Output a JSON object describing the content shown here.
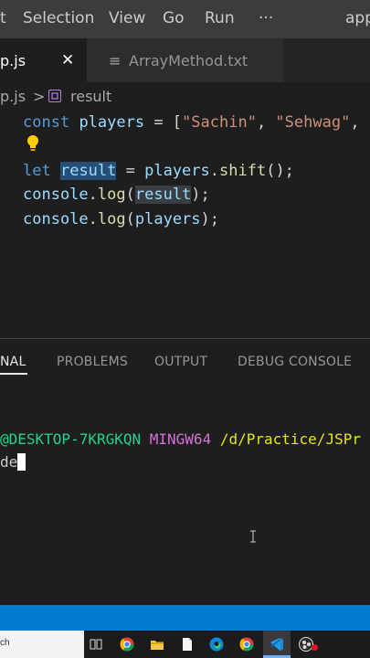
{
  "menubar": {
    "items": [
      "t",
      "Selection",
      "View",
      "Go",
      "Run",
      "···"
    ],
    "title": "app"
  },
  "tabs": {
    "active_label": "p.js",
    "close_glyph": "✕",
    "inactive_label": "ArrayMethod.txt",
    "inactive_icon": "≡"
  },
  "breadcrumb": {
    "file": "p.js",
    "separator": ">",
    "symbol": "result"
  },
  "code": {
    "line1": {
      "kw": "const",
      "var": "players",
      "op": " = [",
      "str1": "\"Sachin\"",
      "sep": ", ",
      "str2": "\"Sehwag\"",
      "tail": ","
    },
    "line3": {
      "kw": "let",
      "var": "result",
      "op": " = ",
      "obj": "players",
      "dot": ".",
      "fn": "shift",
      "tail": "();"
    },
    "line4": {
      "obj": "console",
      "dot": ".",
      "fn": "log",
      "open": "(",
      "arg": "result",
      "close": ");"
    },
    "line5": {
      "obj": "console",
      "dot": ".",
      "fn": "log",
      "open": "(",
      "arg": "players",
      "close": ");"
    }
  },
  "panel": {
    "tabs": [
      "NAL",
      "PROBLEMS",
      "OUTPUT",
      "DEBUG CONSOLE"
    ]
  },
  "terminal": {
    "host": "@DESKTOP-7KRGKQN",
    "env": "MINGW64",
    "path": "/d/Practice/JSPr",
    "input": "de"
  },
  "taskbar": {
    "search_text": "ch"
  },
  "colors": {
    "accent": "#007acc",
    "keyword": "#569cd6",
    "string": "#ce9178",
    "function": "#dcdcaa",
    "variable": "#9cdcfe",
    "terminal_green": "#23d18b",
    "terminal_magenta": "#d670d6",
    "terminal_yellow": "#e5e510"
  }
}
